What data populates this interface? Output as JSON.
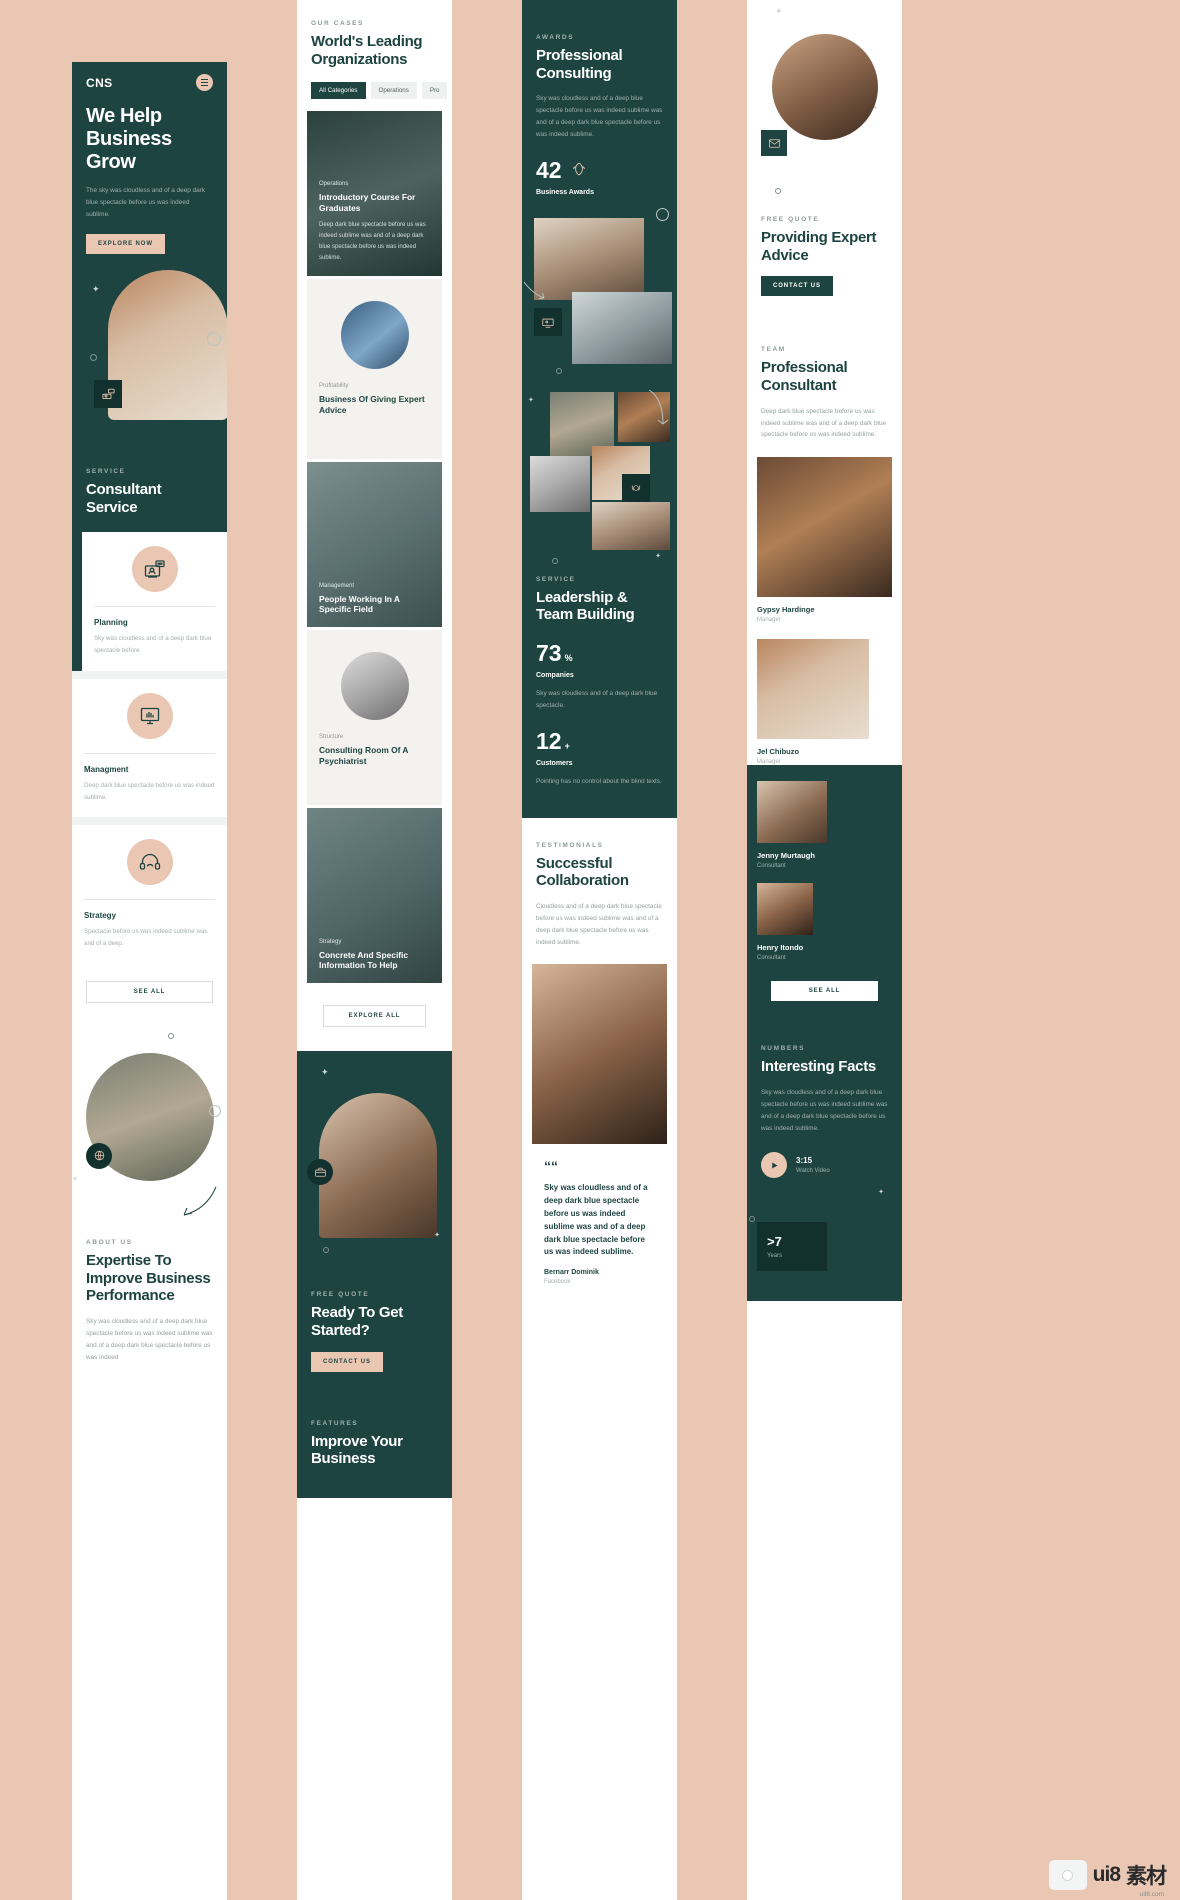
{
  "meta": {
    "watermark": "ui8",
    "watermark_cn": "素材",
    "watermark_sub": "uil8.com"
  },
  "col1": {
    "logo": "CNS",
    "menu_icon": "hamburger-icon",
    "hero": {
      "title": "We Help Business Grow",
      "body": "The sky was cloudless and of a deep dark blue spectacle before us was indeed sublime.",
      "cta": "EXPLORE NOW"
    },
    "service": {
      "eyebrow": "SERVICE",
      "title": "Consultant Service",
      "cards": [
        {
          "icon": "presentation-icon",
          "title": "Planning",
          "body": "Sky was cloudless and of a deep dark blue spectacle before."
        },
        {
          "icon": "hand-monitor-icon",
          "title": "Managment",
          "body": "Deep dark blue spectacle before us was indeed sublime."
        },
        {
          "icon": "headset-support-icon",
          "title": "Strategy",
          "body": "Spectacle before us was indeed sublime was and of a deep."
        }
      ],
      "see_all": "SEE ALL"
    },
    "about": {
      "eyebrow": "ABOUT US",
      "title": "Expertise To Improve Business Performance",
      "body": "Sky was cloudless and of a deep dark blue spectacle before us was indeed sublime was and of a deep dark blue spectacle before us was indeed"
    }
  },
  "col2": {
    "cases": {
      "eyebrow": "OUR CASES",
      "title": "World's Leading Organizations",
      "tabs": [
        {
          "label": "All Categories",
          "active": true
        },
        {
          "label": "Operations",
          "active": false
        },
        {
          "label": "Pro",
          "active": false
        }
      ],
      "items": [
        {
          "kicker": "Operations",
          "title": "Introductory Course For Graduates",
          "sub": "Deep dark blue spectacle before us was indeed sublime was and of a deep dark blue spectacle before us was indeed sublime.",
          "style": "dark"
        },
        {
          "kicker": "Profitability",
          "title": "Business Of Giving Expert Advice",
          "sub": "",
          "style": "light"
        },
        {
          "kicker": "Management",
          "title": "People Working In A Specific Field",
          "sub": "",
          "style": "dark"
        },
        {
          "kicker": "Structure",
          "title": "Consulting Room Of A Psychiatrist",
          "sub": "",
          "style": "light"
        },
        {
          "kicker": "Strategy",
          "title": "Concrete And Specific Information To Help",
          "sub": "",
          "style": "dark"
        }
      ],
      "explore_all": "EXPLORE ALL"
    },
    "quote": {
      "eyebrow": "FREE QUOTE",
      "title": "Ready To Get Started?",
      "cta": "CONTACT US"
    },
    "features": {
      "eyebrow": "FEATURES",
      "title": "Improve Your Business"
    }
  },
  "col3": {
    "awards": {
      "eyebrow": "AWARDS",
      "title": "Professional Consulting",
      "body": "Sky was cloudless and of a deep blue spectacle before us was indeed sublime was and of a deep dark blue spectacle before us was indeed sublime.",
      "stat_value": "42",
      "stat_icon": "laurel-wreath-icon",
      "stat_label": "Business Awards"
    },
    "service": {
      "eyebrow": "SERVICE",
      "title": "Leadership & Team Building",
      "stats": [
        {
          "value": "73",
          "unit": "%",
          "label": "Companies",
          "body": "Sky was cloudless and of a deep dark blue spectacle."
        },
        {
          "value": "12",
          "unit": "+",
          "label": "Customers",
          "body": "Pointing has no control about the blind texts."
        }
      ]
    },
    "testimonials": {
      "eyebrow": "TESTIMONIALS",
      "title": "Successful Collaboration",
      "body": "Cloudless and of a deep dark blue spectacle before us was indeed sublime was and of a deep dark blue spectacle before us was indeed sublime.",
      "quote_mark": "““",
      "quote": "Sky was cloudless and of a deep dark blue spectacle before us was indeed sublime was and of a deep dark blue spectacle before us was indeed sublime.",
      "author": "Bernarr Dominik",
      "author_role": "Facebook"
    }
  },
  "col4": {
    "hero": {
      "mail_icon": "envelope-icon"
    },
    "quote": {
      "eyebrow": "FREE QUOTE",
      "title": "Providing Expert Advice",
      "cta": "CONTACT US"
    },
    "team": {
      "eyebrow": "TEAM",
      "title": "Professional Consultant",
      "body": "Deep dark blue spectacle before us was indeed sublime was and of a deep dark blue spectacle before us was indeed sublime.",
      "members": [
        {
          "name": "Gypsy Hardinge",
          "role": "Manager",
          "on_green": false
        },
        {
          "name": "Jel Chibuzo",
          "role": "Manager",
          "on_green": false
        },
        {
          "name": "Jenny Murtaugh",
          "role": "Consultant",
          "on_green": true
        },
        {
          "name": "Henry Itondo",
          "role": "Consultant",
          "on_green": true
        }
      ],
      "see_all": "SEE ALL"
    },
    "numbers": {
      "eyebrow": "NUMBERS",
      "title": "Interesting Facts",
      "body": "Sky was cloudless and of a deep dark blue spectacle before us was indeed sublime was and of a deep dark blue spectacle before us was indeed sublime.",
      "video_time": "3:15",
      "video_label": "Watch Video",
      "play_icon": "play-icon",
      "boxes": [
        {
          "value": ">7",
          "label": "Years"
        }
      ]
    }
  }
}
